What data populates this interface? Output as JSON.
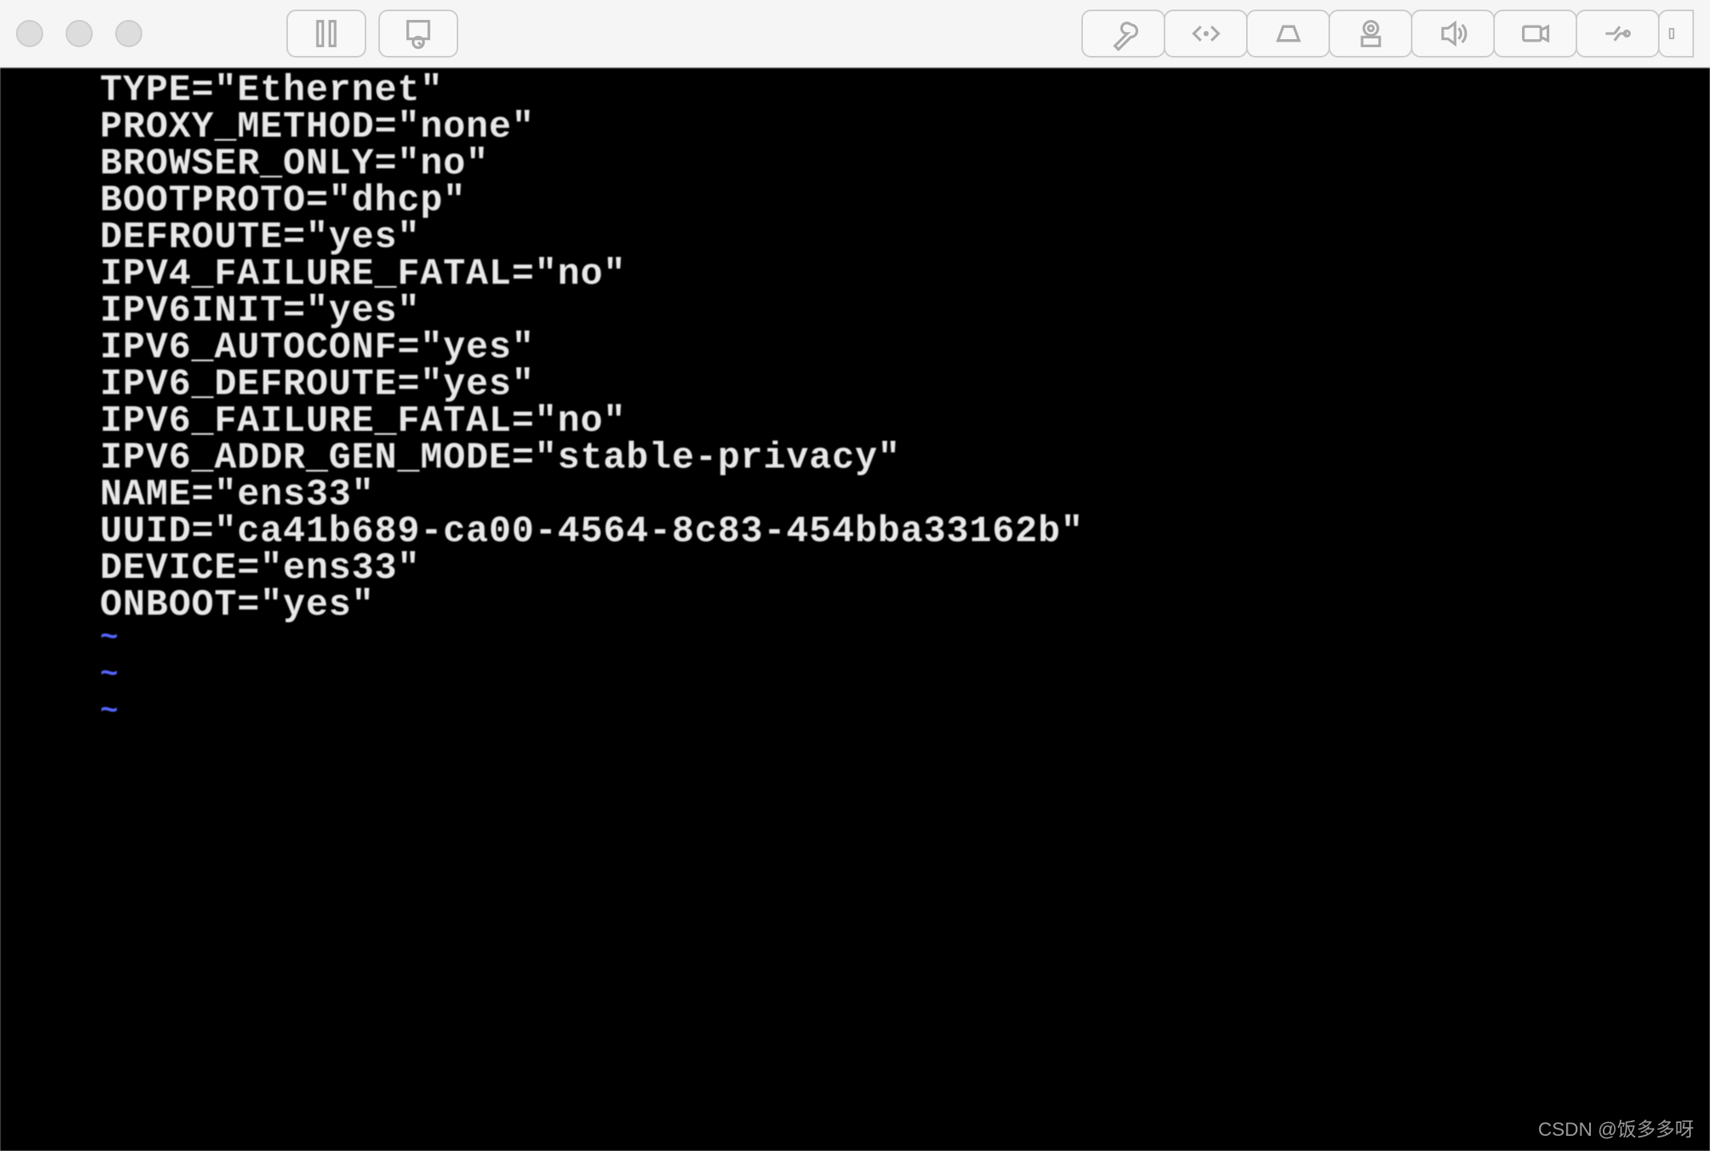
{
  "toolbar": {
    "buttons": {
      "pause": "pause-icon",
      "snapshot": "snapshot-icon",
      "wrench": "wrench-icon",
      "code": "code-icon",
      "disk": "disk-icon",
      "camera": "camera-icon",
      "sound": "sound-icon",
      "video": "video-icon",
      "usb": "usb-icon",
      "more": "more-icon"
    }
  },
  "terminal": {
    "config_lines": [
      "TYPE=\"Ethernet\"",
      "PROXY_METHOD=\"none\"",
      "BROWSER_ONLY=\"no\"",
      "BOOTPROTO=\"dhcp\"",
      "DEFROUTE=\"yes\"",
      "IPV4_FAILURE_FATAL=\"no\"",
      "IPV6INIT=\"yes\"",
      "IPV6_AUTOCONF=\"yes\"",
      "IPV6_DEFROUTE=\"yes\"",
      "IPV6_FAILURE_FATAL=\"no\"",
      "IPV6_ADDR_GEN_MODE=\"stable-privacy\"",
      "NAME=\"ens33\"",
      "UUID=\"ca41b689-ca00-4564-8c83-454bba33162b\"",
      "DEVICE=\"ens33\"",
      "ONBOOT=\"yes\""
    ],
    "tilde_lines": [
      "~",
      "~",
      "~"
    ]
  },
  "watermark": {
    "text": "CSDN @饭多多呀"
  }
}
